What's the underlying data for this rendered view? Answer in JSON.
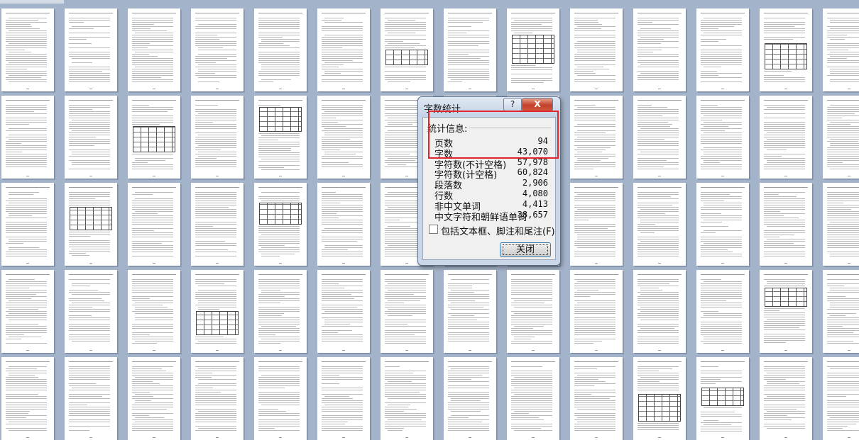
{
  "dialog": {
    "title": "字数统计",
    "help_label": "?",
    "close_label": "X",
    "group_label": "统计信息:",
    "stats": [
      {
        "label": "页数",
        "value": "94"
      },
      {
        "label": "字数",
        "value": "43,070"
      },
      {
        "label": "字符数(不计空格)",
        "value": "57,978"
      },
      {
        "label": "字符数(计空格)",
        "value": "60,824"
      },
      {
        "label": "段落数",
        "value": "2,906"
      },
      {
        "label": "行数",
        "value": "4,080"
      },
      {
        "label": "非中文单词",
        "value": "4,413"
      },
      {
        "label": "中文字符和朝鲜语单词",
        "value": "38,657"
      }
    ],
    "checkbox_label": "包括文本框、脚注和尾注(F)",
    "checkbox_checked": false,
    "ok_label": "关闭"
  },
  "colors": {
    "background": "#a3b3c9",
    "highlight": "#e0262c",
    "dialog_frame": "#c9d7e8"
  }
}
